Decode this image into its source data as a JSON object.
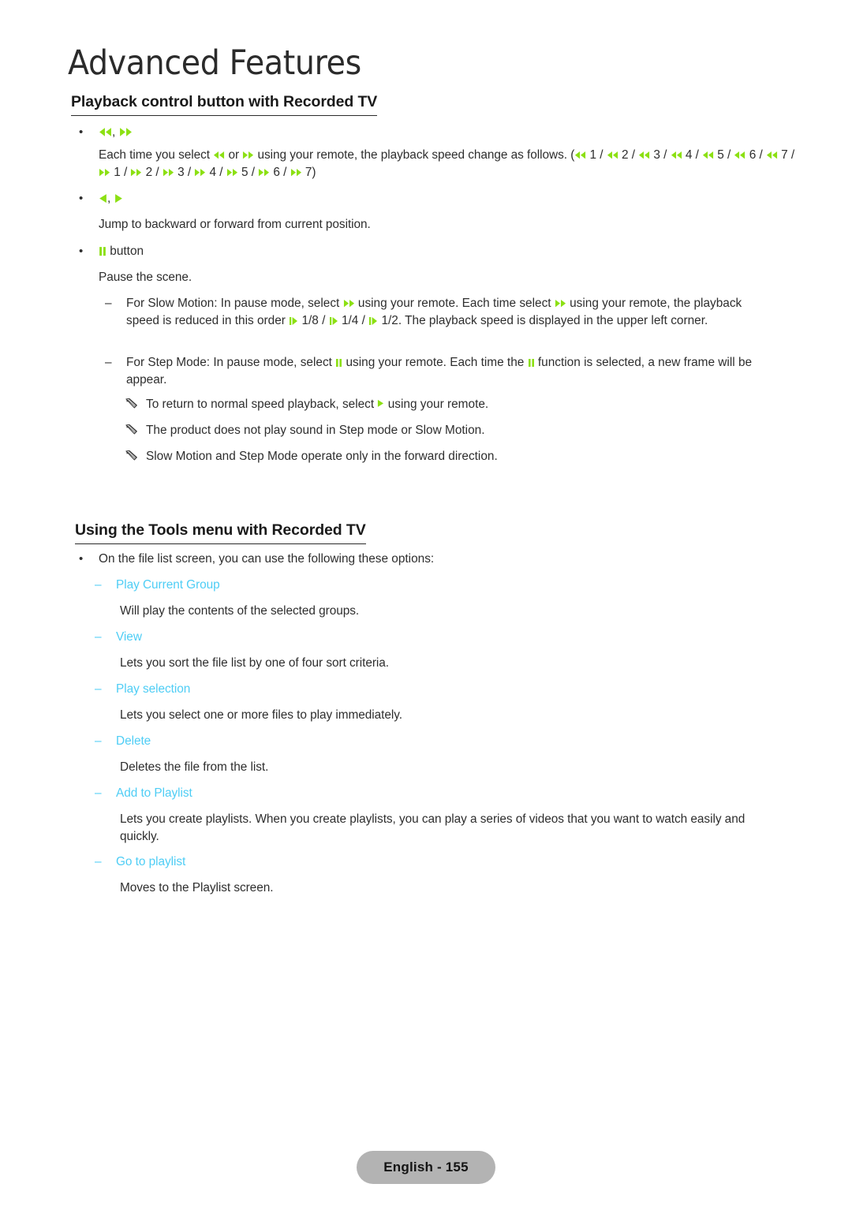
{
  "page": {
    "chapter_title": "Advanced Features",
    "footer_label": "English - 155",
    "accent_green": "#8CE013",
    "accent_cyan": "#4ECDF5",
    "footer_pill_color": "#B3B3B3"
  },
  "section1": {
    "heading": "Playback control button with Recorded TV",
    "bullet1": {
      "icons": [
        "rewind-icon",
        "fast-forward-icon"
      ],
      "separator": ", ",
      "paragraph_part1": "Each time you select ",
      "paragraph_icon1": "rewind-icon",
      "paragraph_part2": " or ",
      "paragraph_icon2": "fast-forward-icon",
      "paragraph_part3": " using your remote, the playback speed change as follows. (",
      "speed_sequence": [
        {
          "icon": "rewind-icon",
          "label": "1"
        },
        {
          "icon": "rewind-icon",
          "label": "2"
        },
        {
          "icon": "rewind-icon",
          "label": "3"
        },
        {
          "icon": "rewind-icon",
          "label": "4"
        },
        {
          "icon": "rewind-icon",
          "label": "5"
        },
        {
          "icon": "rewind-icon",
          "label": "6"
        },
        {
          "icon": "rewind-icon",
          "label": "7"
        },
        {
          "icon": "fast-forward-icon",
          "label": "1"
        },
        {
          "icon": "fast-forward-icon",
          "label": "2"
        },
        {
          "icon": "fast-forward-icon",
          "label": "3"
        },
        {
          "icon": "fast-forward-icon",
          "label": "4"
        },
        {
          "icon": "fast-forward-icon",
          "label": "5"
        },
        {
          "icon": "fast-forward-icon",
          "label": "6"
        },
        {
          "icon": "fast-forward-icon",
          "label": "7"
        }
      ],
      "sequence_separator": " / ",
      "paragraph_close": ")"
    },
    "bullet2": {
      "icons": [
        "jump-backward-icon",
        "jump-forward-icon"
      ],
      "separator": ", ",
      "description": "Jump to backward or forward from current position."
    },
    "bullet3": {
      "icon": "pause-icon",
      "label": " button",
      "description": "Pause the scene."
    },
    "slow_motion": {
      "part1": "For Slow Motion: In pause mode, select ",
      "icon1": "fast-forward-icon",
      "part2": " using your remote. Each time select ",
      "icon2": "fast-forward-icon",
      "part3": " using your remote, the playback speed is reduced in this order ",
      "speeds": [
        {
          "icon": "slow-motion-icon",
          "label": "1/8"
        },
        {
          "icon": "slow-motion-icon",
          "label": "1/4"
        },
        {
          "icon": "slow-motion-icon",
          "label": "1/2"
        }
      ],
      "speed_separator": " / ",
      "part4": ". The playback speed is displayed in the upper left corner."
    },
    "step_mode": {
      "part1": "For Step Mode: In pause mode, select ",
      "icon1": "pause-icon",
      "part2": " using your remote. Each time the ",
      "icon2": "pause-icon",
      "part3": " function is selected, a new frame will be appear."
    },
    "notes": [
      {
        "icon": "note-pencil-icon",
        "part1": "To return to normal speed playback, select ",
        "inline_icon": "play-icon",
        "part2": " using your remote."
      },
      {
        "icon": "note-pencil-icon",
        "part1": "The product does not play sound in Step mode or Slow Motion.",
        "inline_icon": null,
        "part2": ""
      },
      {
        "icon": "note-pencil-icon",
        "part1": "Slow Motion and Step Mode operate only in the forward direction.",
        "inline_icon": null,
        "part2": ""
      }
    ]
  },
  "section2": {
    "heading": "Using the Tools menu with Recorded TV",
    "intro": "On the file list screen, you can use the following these options:",
    "options": [
      {
        "name": "Play Current Group",
        "description": "Will play the contents of the selected groups."
      },
      {
        "name": "View",
        "description": "Lets you sort the file list by one of four sort criteria."
      },
      {
        "name": "Play selection",
        "description": "Lets you select one or more files to play immediately."
      },
      {
        "name": "Delete",
        "description": "Deletes the file from the list."
      },
      {
        "name": "Add to Playlist",
        "description": "Lets you create playlists. When you create playlists, you can play a series of videos that you want to watch easily and quickly."
      },
      {
        "name": "Go to playlist",
        "description": "Moves to the Playlist screen."
      }
    ]
  }
}
